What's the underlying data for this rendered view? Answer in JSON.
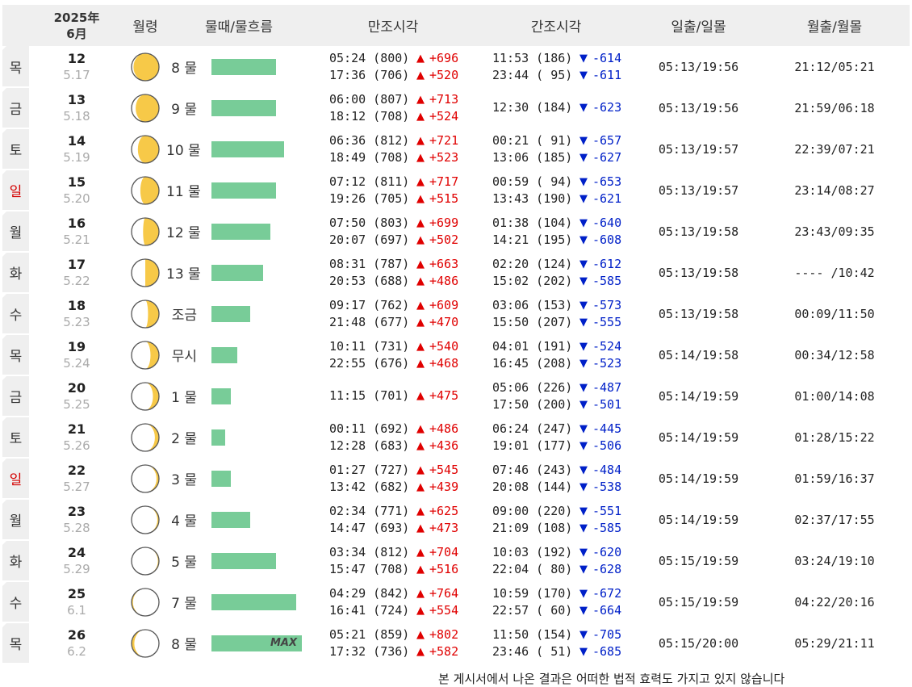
{
  "header": {
    "date_year": "2025年",
    "date_month": "6月",
    "moon_age": "월령",
    "mulddae": "물때/물흐름",
    "high_tide": "만조시각",
    "low_tide": "간조시각",
    "sun": "일출/일몰",
    "moon": "월출/월몰"
  },
  "colors": {
    "bar": "#78cc98",
    "up": "#e00000",
    "down": "#0020c8",
    "moon": "#f7c948",
    "sunday": "#d40000"
  },
  "max_label": "MAX",
  "rows": [
    {
      "day": "목",
      "red": false,
      "date": "12",
      "lunar": "5.17",
      "moon_illum": 0.93,
      "moon_waning": false,
      "mul": "8 물",
      "flow": 0.57,
      "max": false,
      "high": [
        {
          "t": "05:24 (800)",
          "d": "+696"
        },
        {
          "t": "17:36 (706)",
          "d": "+520"
        }
      ],
      "low": [
        {
          "t": "11:53 (186)",
          "d": "-614"
        },
        {
          "t": "23:44 ( 95)",
          "d": "-611"
        }
      ],
      "sun": "05:13/19:56",
      "moon_rs": "21:12/05:21"
    },
    {
      "day": "금",
      "red": false,
      "date": "13",
      "lunar": "5.18",
      "moon_illum": 0.85,
      "moon_waning": false,
      "mul": "9 물",
      "flow": 0.57,
      "max": false,
      "high": [
        {
          "t": "06:00 (807)",
          "d": "+713"
        },
        {
          "t": "18:12 (708)",
          "d": "+524"
        }
      ],
      "low": [
        {
          "t": "12:30 (184)",
          "d": "-623"
        }
      ],
      "sun": "05:13/19:56",
      "moon_rs": "21:59/06:18"
    },
    {
      "day": "토",
      "red": false,
      "date": "14",
      "lunar": "5.19",
      "moon_illum": 0.77,
      "moon_waning": false,
      "mul": "10 물",
      "flow": 0.64,
      "max": false,
      "high": [
        {
          "t": "06:36 (812)",
          "d": "+721"
        },
        {
          "t": "18:49 (708)",
          "d": "+523"
        }
      ],
      "low": [
        {
          "t": "00:21 ( 91)",
          "d": "-657"
        },
        {
          "t": "13:06 (185)",
          "d": "-627"
        }
      ],
      "sun": "05:13/19:57",
      "moon_rs": "22:39/07:21"
    },
    {
      "day": "일",
      "red": true,
      "date": "15",
      "lunar": "5.20",
      "moon_illum": 0.68,
      "moon_waning": false,
      "mul": "11 물",
      "flow": 0.57,
      "max": false,
      "high": [
        {
          "t": "07:12 (811)",
          "d": "+717"
        },
        {
          "t": "19:26 (705)",
          "d": "+515"
        }
      ],
      "low": [
        {
          "t": "00:59 ( 94)",
          "d": "-653"
        },
        {
          "t": "13:43 (190)",
          "d": "-621"
        }
      ],
      "sun": "05:13/19:57",
      "moon_rs": "23:14/08:27"
    },
    {
      "day": "월",
      "red": false,
      "date": "16",
      "lunar": "5.21",
      "moon_illum": 0.58,
      "moon_waning": false,
      "mul": "12 물",
      "flow": 0.52,
      "max": false,
      "high": [
        {
          "t": "07:50 (803)",
          "d": "+699"
        },
        {
          "t": "20:07 (697)",
          "d": "+502"
        }
      ],
      "low": [
        {
          "t": "01:38 (104)",
          "d": "-640"
        },
        {
          "t": "14:21 (195)",
          "d": "-608"
        }
      ],
      "sun": "05:13/19:58",
      "moon_rs": "23:43/09:35"
    },
    {
      "day": "화",
      "red": false,
      "date": "17",
      "lunar": "5.22",
      "moon_illum": 0.5,
      "moon_waning": false,
      "mul": "13 물",
      "flow": 0.46,
      "max": false,
      "high": [
        {
          "t": "08:31 (787)",
          "d": "+663"
        },
        {
          "t": "20:53 (688)",
          "d": "+486"
        }
      ],
      "low": [
        {
          "t": "02:20 (124)",
          "d": "-612"
        },
        {
          "t": "15:02 (202)",
          "d": "-585"
        }
      ],
      "sun": "05:13/19:58",
      "moon_rs": "---- /10:42"
    },
    {
      "day": "수",
      "red": false,
      "date": "18",
      "lunar": "5.23",
      "moon_illum": 0.4,
      "moon_waning": false,
      "mul": "조금",
      "flow": 0.34,
      "max": false,
      "high": [
        {
          "t": "09:17 (762)",
          "d": "+609"
        },
        {
          "t": "21:48 (677)",
          "d": "+470"
        }
      ],
      "low": [
        {
          "t": "03:06 (153)",
          "d": "-573"
        },
        {
          "t": "15:50 (207)",
          "d": "-555"
        }
      ],
      "sun": "05:13/19:58",
      "moon_rs": "00:09/11:50"
    },
    {
      "day": "목",
      "red": false,
      "date": "19",
      "lunar": "5.24",
      "moon_illum": 0.31,
      "moon_waning": false,
      "mul": "무시",
      "flow": 0.23,
      "max": false,
      "high": [
        {
          "t": "10:11 (731)",
          "d": "+540"
        },
        {
          "t": "22:55 (676)",
          "d": "+468"
        }
      ],
      "low": [
        {
          "t": "04:01 (191)",
          "d": "-524"
        },
        {
          "t": "16:45 (208)",
          "d": "-523"
        }
      ],
      "sun": "05:14/19:58",
      "moon_rs": "00:34/12:58"
    },
    {
      "day": "금",
      "red": false,
      "date": "20",
      "lunar": "5.25",
      "moon_illum": 0.22,
      "moon_waning": false,
      "mul": "1 물",
      "flow": 0.17,
      "max": false,
      "high": [
        {
          "t": "11:15 (701)",
          "d": "+475"
        }
      ],
      "low": [
        {
          "t": "05:06 (226)",
          "d": "-487"
        },
        {
          "t": "17:50 (200)",
          "d": "-501"
        }
      ],
      "sun": "05:14/19:59",
      "moon_rs": "01:00/14:08"
    },
    {
      "day": "토",
      "red": false,
      "date": "21",
      "lunar": "5.26",
      "moon_illum": 0.15,
      "moon_waning": false,
      "mul": "2 물",
      "flow": 0.12,
      "max": false,
      "high": [
        {
          "t": "00:11 (692)",
          "d": "+486"
        },
        {
          "t": "12:28 (683)",
          "d": "+436"
        }
      ],
      "low": [
        {
          "t": "06:24 (247)",
          "d": "-445"
        },
        {
          "t": "19:01 (177)",
          "d": "-506"
        }
      ],
      "sun": "05:14/19:59",
      "moon_rs": "01:28/15:22"
    },
    {
      "day": "일",
      "red": true,
      "date": "22",
      "lunar": "5.27",
      "moon_illum": 0.09,
      "moon_waning": false,
      "mul": "3 물",
      "flow": 0.17,
      "max": false,
      "high": [
        {
          "t": "01:27 (727)",
          "d": "+545"
        },
        {
          "t": "13:42 (682)",
          "d": "+439"
        }
      ],
      "low": [
        {
          "t": "07:46 (243)",
          "d": "-484"
        },
        {
          "t": "20:08 (144)",
          "d": "-538"
        }
      ],
      "sun": "05:14/19:59",
      "moon_rs": "01:59/16:37"
    },
    {
      "day": "월",
      "red": false,
      "date": "23",
      "lunar": "5.28",
      "moon_illum": 0.06,
      "moon_waning": false,
      "mul": "4 물",
      "flow": 0.34,
      "max": false,
      "high": [
        {
          "t": "02:34 (771)",
          "d": "+625"
        },
        {
          "t": "14:47 (693)",
          "d": "+473"
        }
      ],
      "low": [
        {
          "t": "09:00 (220)",
          "d": "-551"
        },
        {
          "t": "21:09 (108)",
          "d": "-585"
        }
      ],
      "sun": "05:14/19:59",
      "moon_rs": "02:37/17:55"
    },
    {
      "day": "화",
      "red": false,
      "date": "24",
      "lunar": "5.29",
      "moon_illum": 0.04,
      "moon_waning": false,
      "mul": "5 물",
      "flow": 0.57,
      "max": false,
      "high": [
        {
          "t": "03:34 (812)",
          "d": "+704"
        },
        {
          "t": "15:47 (708)",
          "d": "+516"
        }
      ],
      "low": [
        {
          "t": "10:03 (192)",
          "d": "-620"
        },
        {
          "t": "22:04 ( 80)",
          "d": "-628"
        }
      ],
      "sun": "05:15/19:59",
      "moon_rs": "03:24/19:10"
    },
    {
      "day": "수",
      "red": false,
      "date": "25",
      "lunar": "6.1",
      "moon_illum": 0.05,
      "moon_waning": true,
      "mul": "7 물",
      "flow": 0.75,
      "max": false,
      "high": [
        {
          "t": "04:29 (842)",
          "d": "+764"
        },
        {
          "t": "16:41 (724)",
          "d": "+554"
        }
      ],
      "low": [
        {
          "t": "10:59 (170)",
          "d": "-672"
        },
        {
          "t": "22:57 ( 60)",
          "d": "-664"
        }
      ],
      "sun": "05:15/19:59",
      "moon_rs": "04:22/20:16"
    },
    {
      "day": "목",
      "red": false,
      "date": "26",
      "lunar": "6.2",
      "moon_illum": 0.1,
      "moon_waning": true,
      "mul": "8 물",
      "flow": 0.8,
      "max": true,
      "high": [
        {
          "t": "05:21 (859)",
          "d": "+802"
        },
        {
          "t": "17:32 (736)",
          "d": "+582"
        }
      ],
      "low": [
        {
          "t": "11:50 (154)",
          "d": "-705"
        },
        {
          "t": "23:46 ( 51)",
          "d": "-685"
        }
      ],
      "sun": "05:15/20:00",
      "moon_rs": "05:29/21:11"
    }
  ],
  "footnote": "본 게시서에서 나온 결과은 어떠한 법적 효력도 가지고 있지 않습니다"
}
